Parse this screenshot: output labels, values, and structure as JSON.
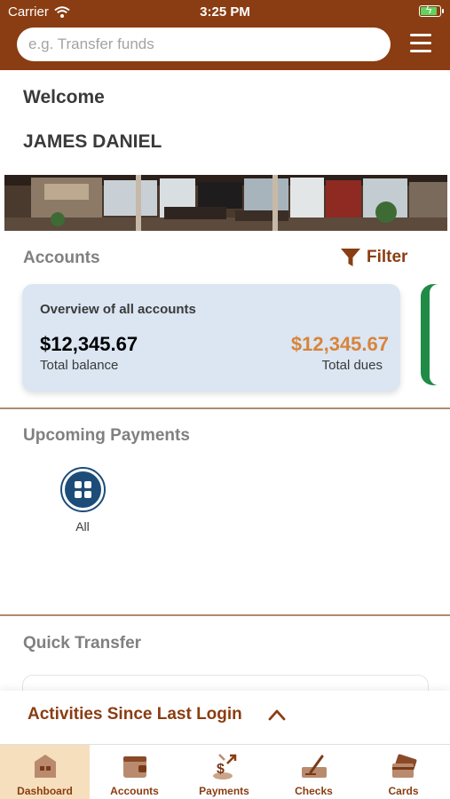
{
  "status_bar": {
    "carrier": "Carrier",
    "time": "3:25 PM",
    "battery_level": 0.9
  },
  "search": {
    "placeholder": "e.g. Transfer funds"
  },
  "welcome": {
    "greeting": "Welcome",
    "user_name": "JAMES DANIEL"
  },
  "accounts": {
    "title": "Accounts",
    "filter_label": "Filter",
    "card": {
      "title": "Overview of all accounts",
      "total_balance": "$12,345.67",
      "total_balance_label": "Total balance",
      "total_dues": "$12,345.67",
      "total_dues_label": "Total dues"
    }
  },
  "upcoming_payments": {
    "title": "Upcoming Payments",
    "filter_all_label": "All"
  },
  "quick_transfer": {
    "title": "Quick Transfer"
  },
  "activities": {
    "label": "Activities Since Last Login"
  },
  "tabs": [
    {
      "label": "Dashboard",
      "icon": "dashboard-icon",
      "active": true
    },
    {
      "label": "Accounts",
      "icon": "wallet-icon",
      "active": false
    },
    {
      "label": "Payments",
      "icon": "payments-icon",
      "active": false
    },
    {
      "label": "Checks",
      "icon": "check-icon",
      "active": false
    },
    {
      "label": "Cards",
      "icon": "card-icon",
      "active": false
    }
  ],
  "colors": {
    "brand": "#8a3d12",
    "dues": "#d8843c",
    "card_bg": "#dbe6f2",
    "active_tab": "#f6dfbd",
    "payment_filter": "#1c4d79"
  }
}
